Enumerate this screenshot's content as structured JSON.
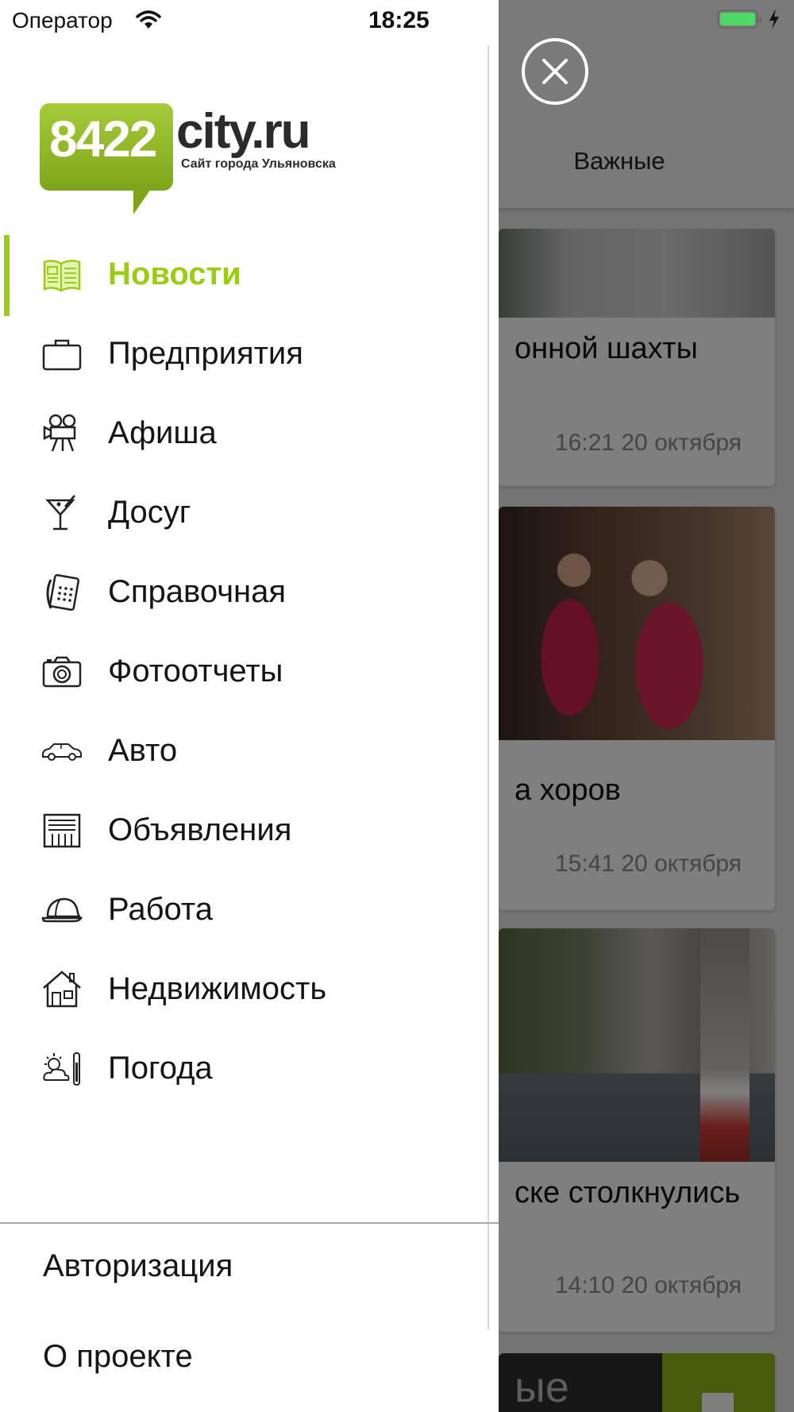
{
  "status_bar": {
    "carrier": "Оператор",
    "time": "18:25"
  },
  "logo": {
    "number": "8422",
    "site": "city.ru",
    "tagline": "Сайт города Ульяновска",
    "accent_color": "#8fb81b"
  },
  "menu": {
    "active_color": "#9acc12",
    "items": [
      {
        "label": "Новости",
        "icon": "newspaper-icon",
        "active": true
      },
      {
        "label": "Предприятия",
        "icon": "briefcase-icon"
      },
      {
        "label": "Афиша",
        "icon": "movie-camera-icon"
      },
      {
        "label": "Досуг",
        "icon": "cocktail-icon"
      },
      {
        "label": "Справочная",
        "icon": "phone-icon"
      },
      {
        "label": "Фотоотчеты",
        "icon": "camera-icon"
      },
      {
        "label": "Авто",
        "icon": "car-icon"
      },
      {
        "label": "Объявления",
        "icon": "ads-board-icon"
      },
      {
        "label": "Работа",
        "icon": "hard-hat-icon"
      },
      {
        "label": "Недвижимость",
        "icon": "house-icon"
      },
      {
        "label": "Погода",
        "icon": "weather-icon"
      }
    ],
    "footer": [
      {
        "label": "Авторизация"
      },
      {
        "label": "О проекте"
      }
    ]
  },
  "background": {
    "tab_label": "Важные",
    "cards": [
      {
        "title": "онной шахты",
        "time": "16:21 20 октября"
      },
      {
        "title": "а хоров",
        "time": "15:41 20 октября"
      },
      {
        "title": "ске столкнулись",
        "time": "14:10 20 октября"
      },
      {
        "title": "ые"
      }
    ]
  }
}
